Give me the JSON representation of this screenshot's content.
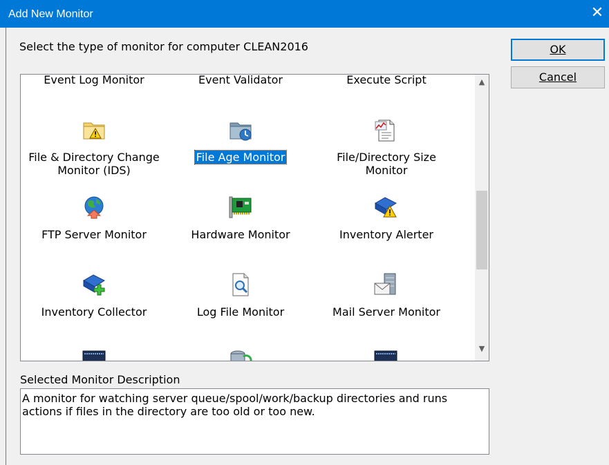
{
  "window": {
    "title": "Add New Monitor",
    "close_glyph": "✕"
  },
  "prompt": "Select the type of monitor for computer CLEAN2016",
  "buttons": {
    "ok": "OK",
    "cancel": "Cancel"
  },
  "monitors": [
    {
      "label": "Event Log Monitor"
    },
    {
      "label": "Event Validator"
    },
    {
      "label": "Execute Script"
    },
    {
      "label": "File & Directory Change Monitor (IDS)",
      "icon": "folder-warning-icon"
    },
    {
      "label": "File Age Monitor",
      "icon": "folder-clock-icon",
      "selected": true
    },
    {
      "label": "File/Directory Size Monitor",
      "icon": "document-chart-icon"
    },
    {
      "label": "FTP Server Monitor",
      "icon": "globe-upload-icon"
    },
    {
      "label": "Hardware Monitor",
      "icon": "circuit-board-icon"
    },
    {
      "label": "Inventory Alerter",
      "icon": "book-warning-icon"
    },
    {
      "label": "Inventory Collector",
      "icon": "book-add-icon"
    },
    {
      "label": "Log File Monitor",
      "icon": "document-search-icon"
    },
    {
      "label": "Mail Server Monitor",
      "icon": "mail-server-icon"
    }
  ],
  "description": {
    "label": "Selected Monitor Description",
    "text": "A monitor for watching server queue/spool/work/backup directories and runs actions if files in the directory are too old or too new."
  },
  "colors": {
    "titlebar": "#0078d7",
    "selection": "#0078d7"
  }
}
